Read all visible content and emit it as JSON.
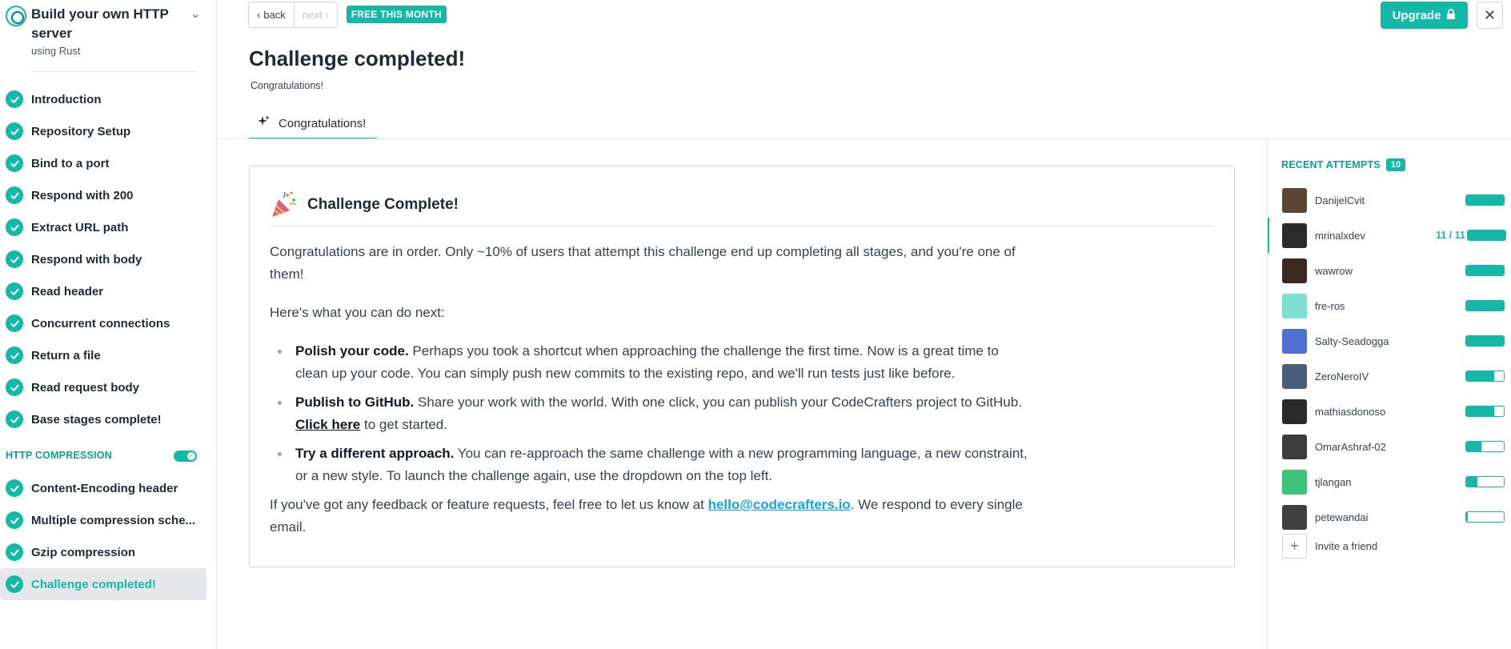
{
  "course": {
    "title": "Build your own HTTP server",
    "subtitle": "using Rust"
  },
  "sidebar": {
    "base_stages": [
      {
        "label": "Introduction"
      },
      {
        "label": "Repository Setup"
      },
      {
        "label": "Bind to a port"
      },
      {
        "label": "Respond with 200"
      },
      {
        "label": "Extract URL path"
      },
      {
        "label": "Respond with body"
      },
      {
        "label": "Read header"
      },
      {
        "label": "Concurrent connections"
      },
      {
        "label": "Return a file"
      },
      {
        "label": "Read request body"
      },
      {
        "label": "Base stages complete!"
      }
    ],
    "extension": {
      "title": "HTTP COMPRESSION",
      "enabled": true,
      "stages": [
        {
          "label": "Content-Encoding header"
        },
        {
          "label": "Multiple compression sche..."
        },
        {
          "label": "Gzip compression"
        },
        {
          "label": "Challenge completed!"
        }
      ]
    }
  },
  "topbar": {
    "back_label": "back",
    "next_label": "next",
    "badge": "FREE THIS MONTH",
    "upgrade_label": "Upgrade"
  },
  "header": {
    "title": "Challenge completed!",
    "subtitle": "Congratulations!",
    "tab_label": "Congratulations!"
  },
  "card": {
    "title": "Challenge Complete!",
    "intro": "Congratulations are in order. Only ~10% of users that attempt this challenge end up completing all stages, and you're one of them!",
    "next_heading": "Here's what you can do next:",
    "items": [
      {
        "bold": "Polish your code.",
        "text": " Perhaps you took a shortcut when approaching the challenge the first time. Now is a great time to clean up your code. You can simply push new commits to the existing repo, and we'll run tests just like before."
      },
      {
        "bold": "Publish to GitHub.",
        "text": " Share your work with the world. With one click, you can publish your CodeCrafters project to GitHub. ",
        "link": "Click here",
        "after": " to get started."
      },
      {
        "bold": "Try a different approach.",
        "text": " You can re-approach the same challenge with a new programming language, a new constraint, or a new style. To launch the challenge again, use the dropdown on the top left."
      }
    ],
    "feedback_before": "If you've got any feedback or feature requests, feel free to let us know at ",
    "feedback_email": "hello@codecrafters.io",
    "feedback_after": ". We respond to every single email."
  },
  "recent_attempts": {
    "title": "RECENT ATTEMPTS",
    "count": "10",
    "users": [
      {
        "name": "DanijelCvit",
        "progress": 1.0,
        "avatar": "#5b4636"
      },
      {
        "name": "mrinalxdev",
        "progress": 1.0,
        "progress_text": "11 / 11",
        "avatar": "#2b2b2b",
        "selected": true
      },
      {
        "name": "wawrow",
        "progress": 1.0,
        "avatar": "#3b2a22"
      },
      {
        "name": "fre-ros",
        "progress": 1.0,
        "avatar": "#7ee0d0"
      },
      {
        "name": "Salty-Seadogga",
        "progress": 1.0,
        "avatar": "#4f6fd1"
      },
      {
        "name": "ZeroNeroIV",
        "progress": 0.75,
        "avatar": "#4a5d7a"
      },
      {
        "name": "mathiasdonoso",
        "progress": 0.75,
        "avatar": "#2a2a2a"
      },
      {
        "name": "OmarAshraf-02",
        "progress": 0.4,
        "avatar": "#3d3d3d"
      },
      {
        "name": "tjlangan",
        "progress": 0.3,
        "avatar": "#3ec27a"
      },
      {
        "name": "petewandai",
        "progress": 0.05,
        "avatar": "#404040"
      }
    ],
    "invite_label": "Invite a friend"
  },
  "colors": {
    "accent": "#14b8a6",
    "link": "#0ea5e9"
  }
}
